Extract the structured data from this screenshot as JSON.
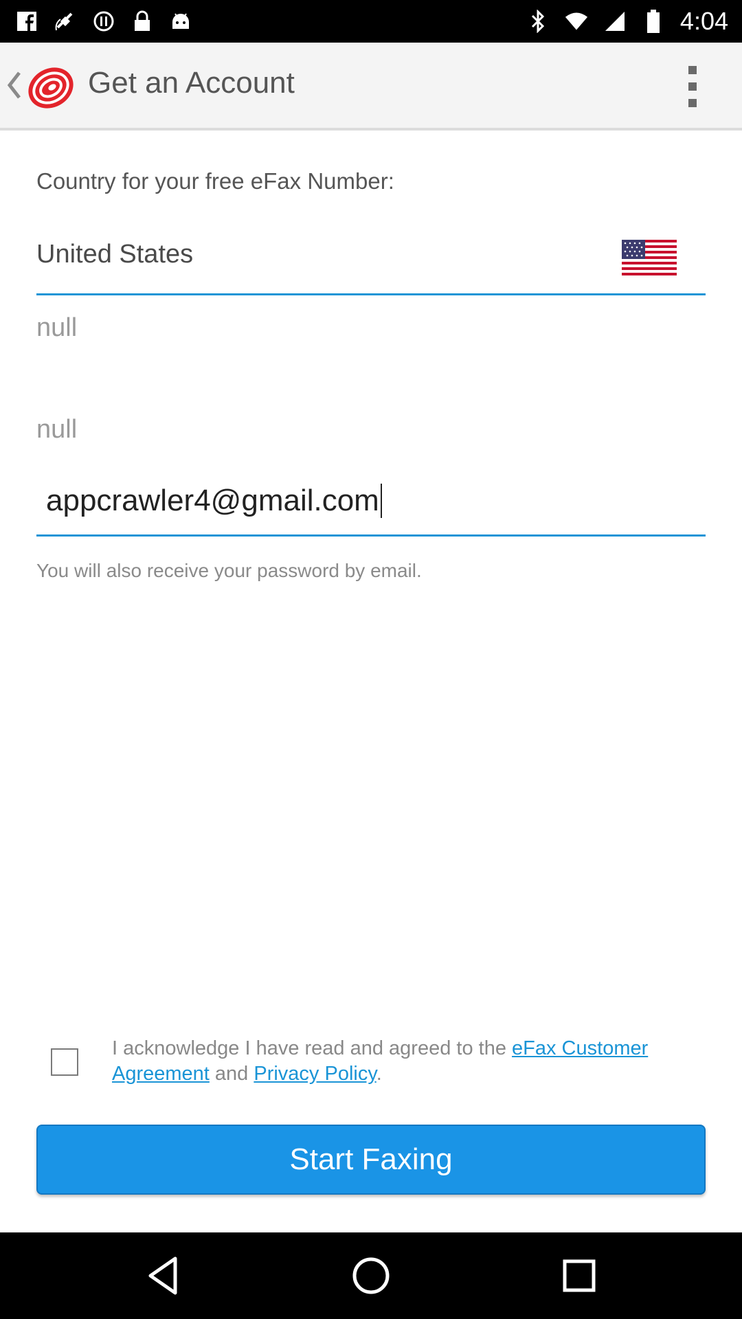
{
  "status_bar": {
    "time": "4:04",
    "left_icons": [
      "facebook-icon",
      "fake-gps-icon",
      "sync-icon",
      "lock-icon",
      "android-icon"
    ],
    "right_icons": [
      "bluetooth-icon",
      "wifi-icon",
      "signal-icon",
      "battery-icon"
    ]
  },
  "action_bar": {
    "title": "Get an Account",
    "logo_color": "#e3242b"
  },
  "form": {
    "country_label": "Country for your free eFax Number:",
    "country_value": "United States",
    "null_field_1": "null",
    "null_field_2": "null",
    "email_value": "appcrawler4@gmail.com",
    "hint": "You will also receive your password by email."
  },
  "acknowledge": {
    "text_before": "I acknowledge I have read and agreed to the ",
    "link_agreement": "eFax Customer Agreement",
    "text_and": " and ",
    "link_privacy": "Privacy Policy",
    "text_after": ".",
    "checked": false
  },
  "start_button": "Start Faxing",
  "colors": {
    "accent": "#1a94e6",
    "link": "#1a94d6"
  }
}
